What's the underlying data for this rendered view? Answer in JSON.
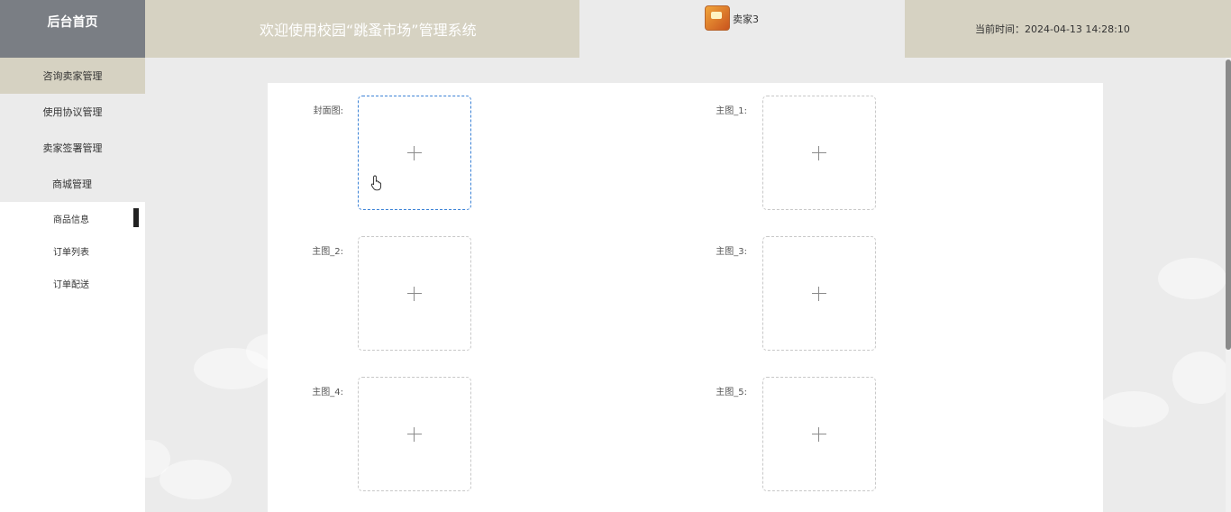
{
  "header": {
    "brand": "后台首页",
    "title": "欢迎使用校园“跳蚤市场”管理系统",
    "username": "卖家3",
    "time_text": "当前时间：2024-04-13 14:28:10"
  },
  "sidebar": {
    "items": [
      {
        "label": "咨询卖家管理"
      },
      {
        "label": "使用协议管理"
      },
      {
        "label": "卖家签署管理"
      },
      {
        "label": "商城管理"
      }
    ],
    "sub_items": [
      {
        "label": "商品信息"
      },
      {
        "label": "订单列表"
      },
      {
        "label": "订单配送"
      }
    ]
  },
  "form": {
    "fields": [
      {
        "label": "封面图:"
      },
      {
        "label": "主图_1:"
      },
      {
        "label": "主图_2:"
      },
      {
        "label": "主图_3:"
      },
      {
        "label": "主图_4:"
      },
      {
        "label": "主图_5:"
      }
    ]
  },
  "colors": {
    "header_dark": "#7a7e84",
    "header_beige": "#d6d2c2",
    "upload_focus": "#3b82d6"
  }
}
